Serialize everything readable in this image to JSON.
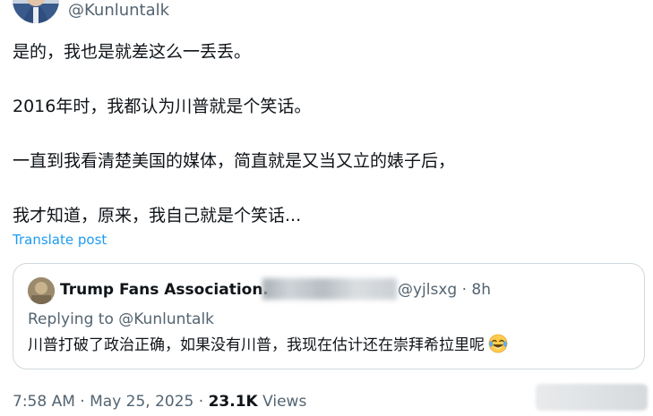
{
  "author": {
    "handle": "@Kunluntalk"
  },
  "tweet": {
    "lines": [
      "是的，我也是就差这么一丢丢。",
      "2016年时，我都认为川普就是个笑话。",
      "一直到我看清楚美国的媒体，简直就是又当又立的婊子后，",
      "我才知道，原来，我自己就是个笑话..."
    ],
    "translate_label": "Translate post"
  },
  "quoted": {
    "name": "Trump Fans Association.",
    "handle_time": "@yjlsxg · 8h",
    "replying_prefix": "Replying to ",
    "replying_mention": "@Kunluntalk",
    "text": "川普打破了政治正确，如果没有川普，我现在估计还在崇拜希拉里呢",
    "emoji_icon": "face-with-tears-of-joy-icon"
  },
  "meta": {
    "time": "7:58 AM",
    "separator1": " · ",
    "date": "May 25, 2025",
    "separator2": " · ",
    "views_count": "23.1K",
    "views_label": " Views"
  },
  "colors": {
    "link": "#1d9bf0",
    "secondary_text": "#536471",
    "primary_text": "#0f1419",
    "border": "#cfd9de"
  }
}
